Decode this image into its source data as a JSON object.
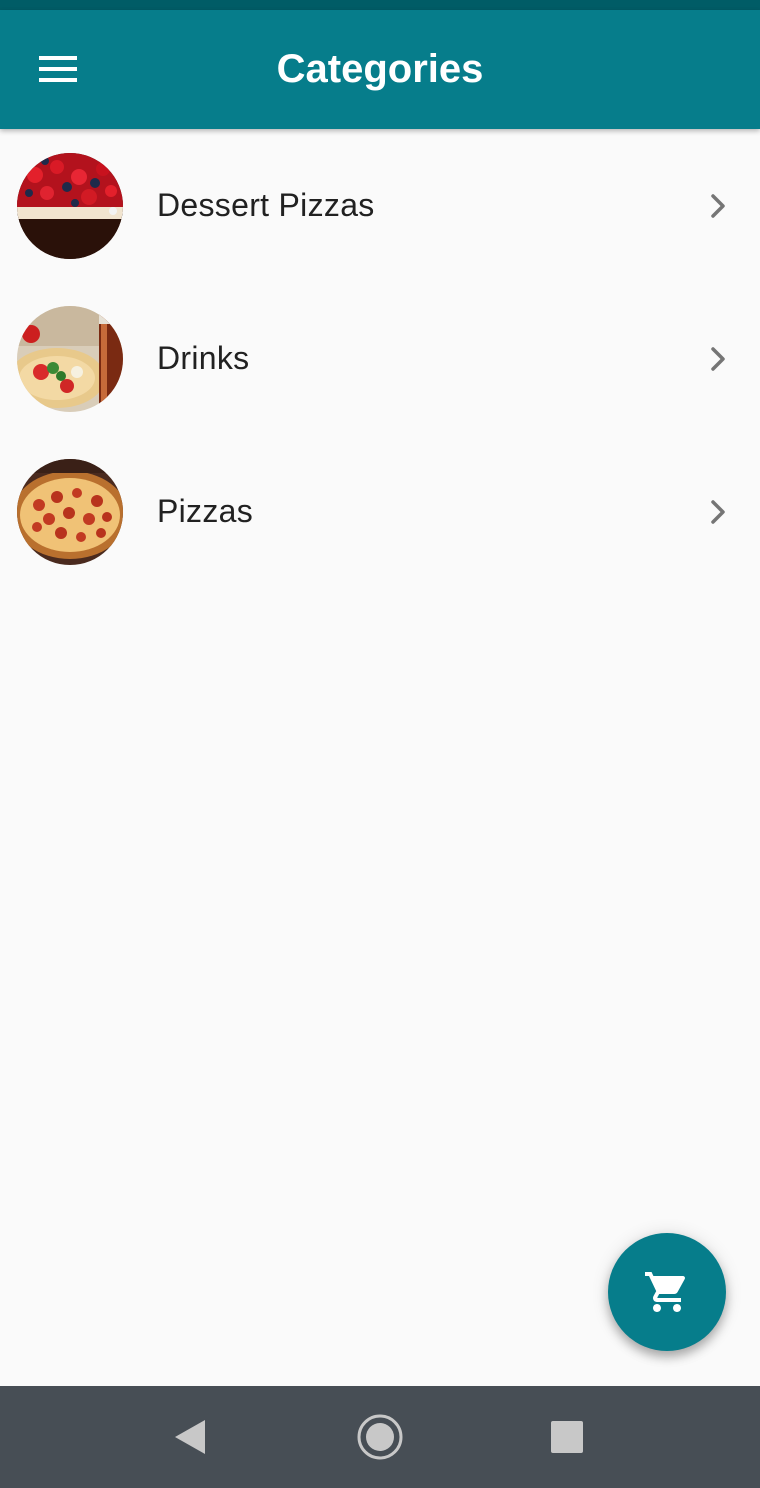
{
  "app_bar": {
    "title": "Categories",
    "menu_icon": "hamburger-menu-icon",
    "background": "#067d8b"
  },
  "categories": [
    {
      "label": "Dessert Pizzas",
      "image": "dessert-pizza-thumbnail",
      "trailing_icon": "chevron-right-icon"
    },
    {
      "label": "Drinks",
      "image": "drinks-thumbnail",
      "trailing_icon": "chevron-right-icon"
    },
    {
      "label": "Pizzas",
      "image": "pepperoni-pizza-thumbnail",
      "trailing_icon": "chevron-right-icon"
    }
  ],
  "fab": {
    "icon": "shopping-cart-icon",
    "color": "#067d8b"
  },
  "system_nav": {
    "back_icon": "back-triangle-icon",
    "home_icon": "home-circle-icon",
    "recents_icon": "recents-square-icon"
  }
}
